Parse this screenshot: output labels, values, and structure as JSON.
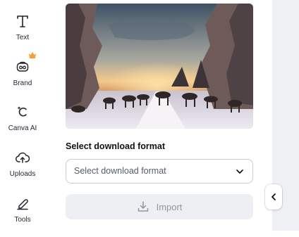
{
  "sidebar": {
    "items": [
      {
        "label": "Text",
        "icon": "text-icon"
      },
      {
        "label": "Brand",
        "icon": "brand-icon",
        "badge": "crown-icon"
      },
      {
        "label": "Canva AI",
        "icon": "canva-ai-icon"
      },
      {
        "label": "Uploads",
        "icon": "uploads-icon"
      },
      {
        "label": "Tools",
        "icon": "tools-icon"
      }
    ]
  },
  "panel": {
    "section_label": "Select download format",
    "format_select": {
      "placeholder": "Select download format"
    },
    "import_button": {
      "label": "Import",
      "icon": "download-icon",
      "enabled": false
    }
  },
  "colors": {
    "crown": "#f2a23a",
    "import_bg": "#edeff2",
    "import_text": "#8f96a3",
    "canvas_bg": "#eef0f3"
  }
}
